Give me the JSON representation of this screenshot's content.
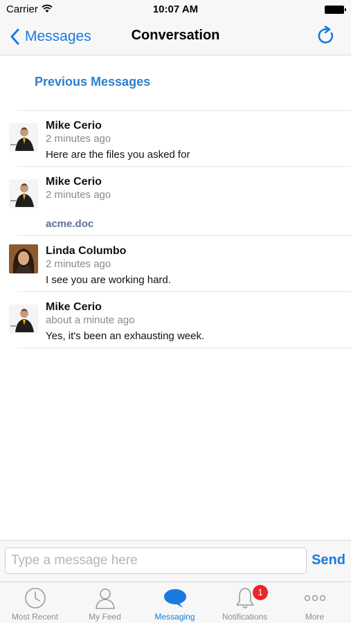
{
  "status_bar": {
    "carrier": "Carrier",
    "time": "10:07 AM"
  },
  "nav": {
    "back_label": "Messages",
    "title": "Conversation"
  },
  "content": {
    "previous_messages_label": "Previous Messages",
    "messages": [
      {
        "sender": "Mike Cerio",
        "time": "2 minutes ago",
        "text": "Here are the files you asked for",
        "avatar": "mike"
      },
      {
        "sender": "Mike Cerio",
        "time": "2 minutes ago",
        "attachment": "acme.doc",
        "avatar": "mike"
      },
      {
        "sender": "Linda Columbo",
        "time": "2 minutes ago",
        "text": "I see you are working hard.",
        "avatar": "linda"
      },
      {
        "sender": "Mike Cerio",
        "time": "about a minute ago",
        "text": "Yes, it's been an exhausting week.",
        "avatar": "mike"
      }
    ]
  },
  "composer": {
    "placeholder": "Type a message here",
    "send_label": "Send"
  },
  "tabs": [
    {
      "label": "Most Recent",
      "icon": "clock-icon",
      "active": false
    },
    {
      "label": "My Feed",
      "icon": "person-icon",
      "active": false
    },
    {
      "label": "Messaging",
      "icon": "chat-bubble-icon",
      "active": true
    },
    {
      "label": "Notifications",
      "icon": "bell-icon",
      "active": false,
      "badge": "1"
    },
    {
      "label": "More",
      "icon": "more-dots-icon",
      "active": false
    }
  ],
  "colors": {
    "accent": "#1a7ae0",
    "badge": "#e8262b",
    "attachment_link": "#5d6f99"
  }
}
